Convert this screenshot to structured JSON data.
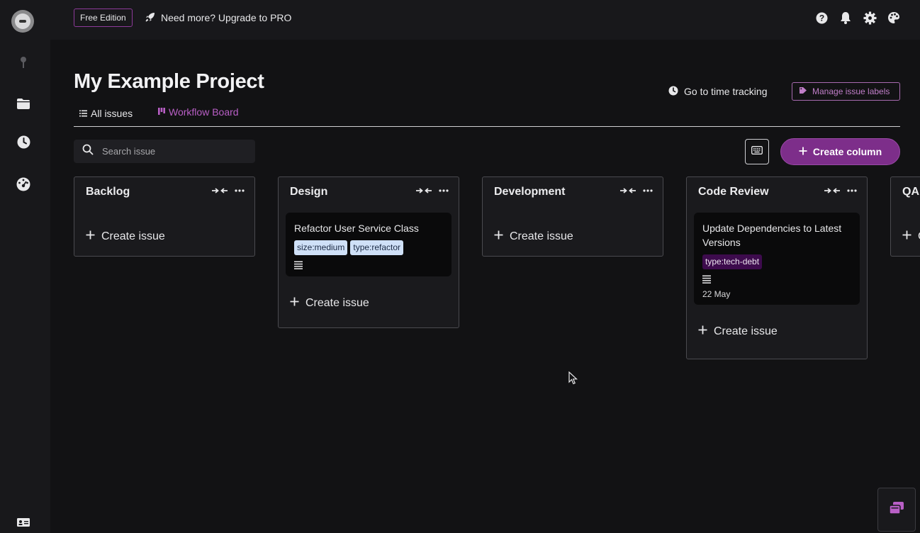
{
  "topbar": {
    "edition_badge": "Free Edition",
    "upgrade_text": "Need more? Upgrade to PRO"
  },
  "header": {
    "title": "My Example Project",
    "time_tracking_link": "Go to time tracking",
    "manage_labels_button": "Manage issue labels"
  },
  "tabs": {
    "all_issues": "All issues",
    "workflow_board": "Workflow Board"
  },
  "search": {
    "placeholder": "Search issue"
  },
  "toolbar": {
    "create_column_label": "Create column"
  },
  "columns": [
    {
      "title": "Backlog",
      "create_label": "Create issue"
    },
    {
      "title": "Design",
      "create_label": "Create issue",
      "card": {
        "title": "Refactor User Service Class",
        "labels": [
          "size:medium",
          "type:refactor"
        ]
      }
    },
    {
      "title": "Development",
      "create_label": "Create issue"
    },
    {
      "title": "Code Review",
      "create_label": "Create issue",
      "card": {
        "title": "Update Dependencies to Latest Versions",
        "labels": [
          "type:tech-debt"
        ],
        "date": "22 May"
      }
    },
    {
      "title": "QA",
      "create_label": "C"
    }
  ],
  "colors": {
    "accent": "#7d2e8a",
    "accent_text": "#b95fc6",
    "background": "#121214",
    "panel": "#1a1a1d"
  },
  "icons": {
    "sidebar": [
      "logo",
      "pin-icon",
      "folder-icon",
      "clock-icon",
      "dashboard-icon",
      "id-card-icon"
    ],
    "topbar": [
      "rocket-icon",
      "help-icon",
      "bell-icon",
      "gear-icon",
      "palette-icon"
    ]
  }
}
